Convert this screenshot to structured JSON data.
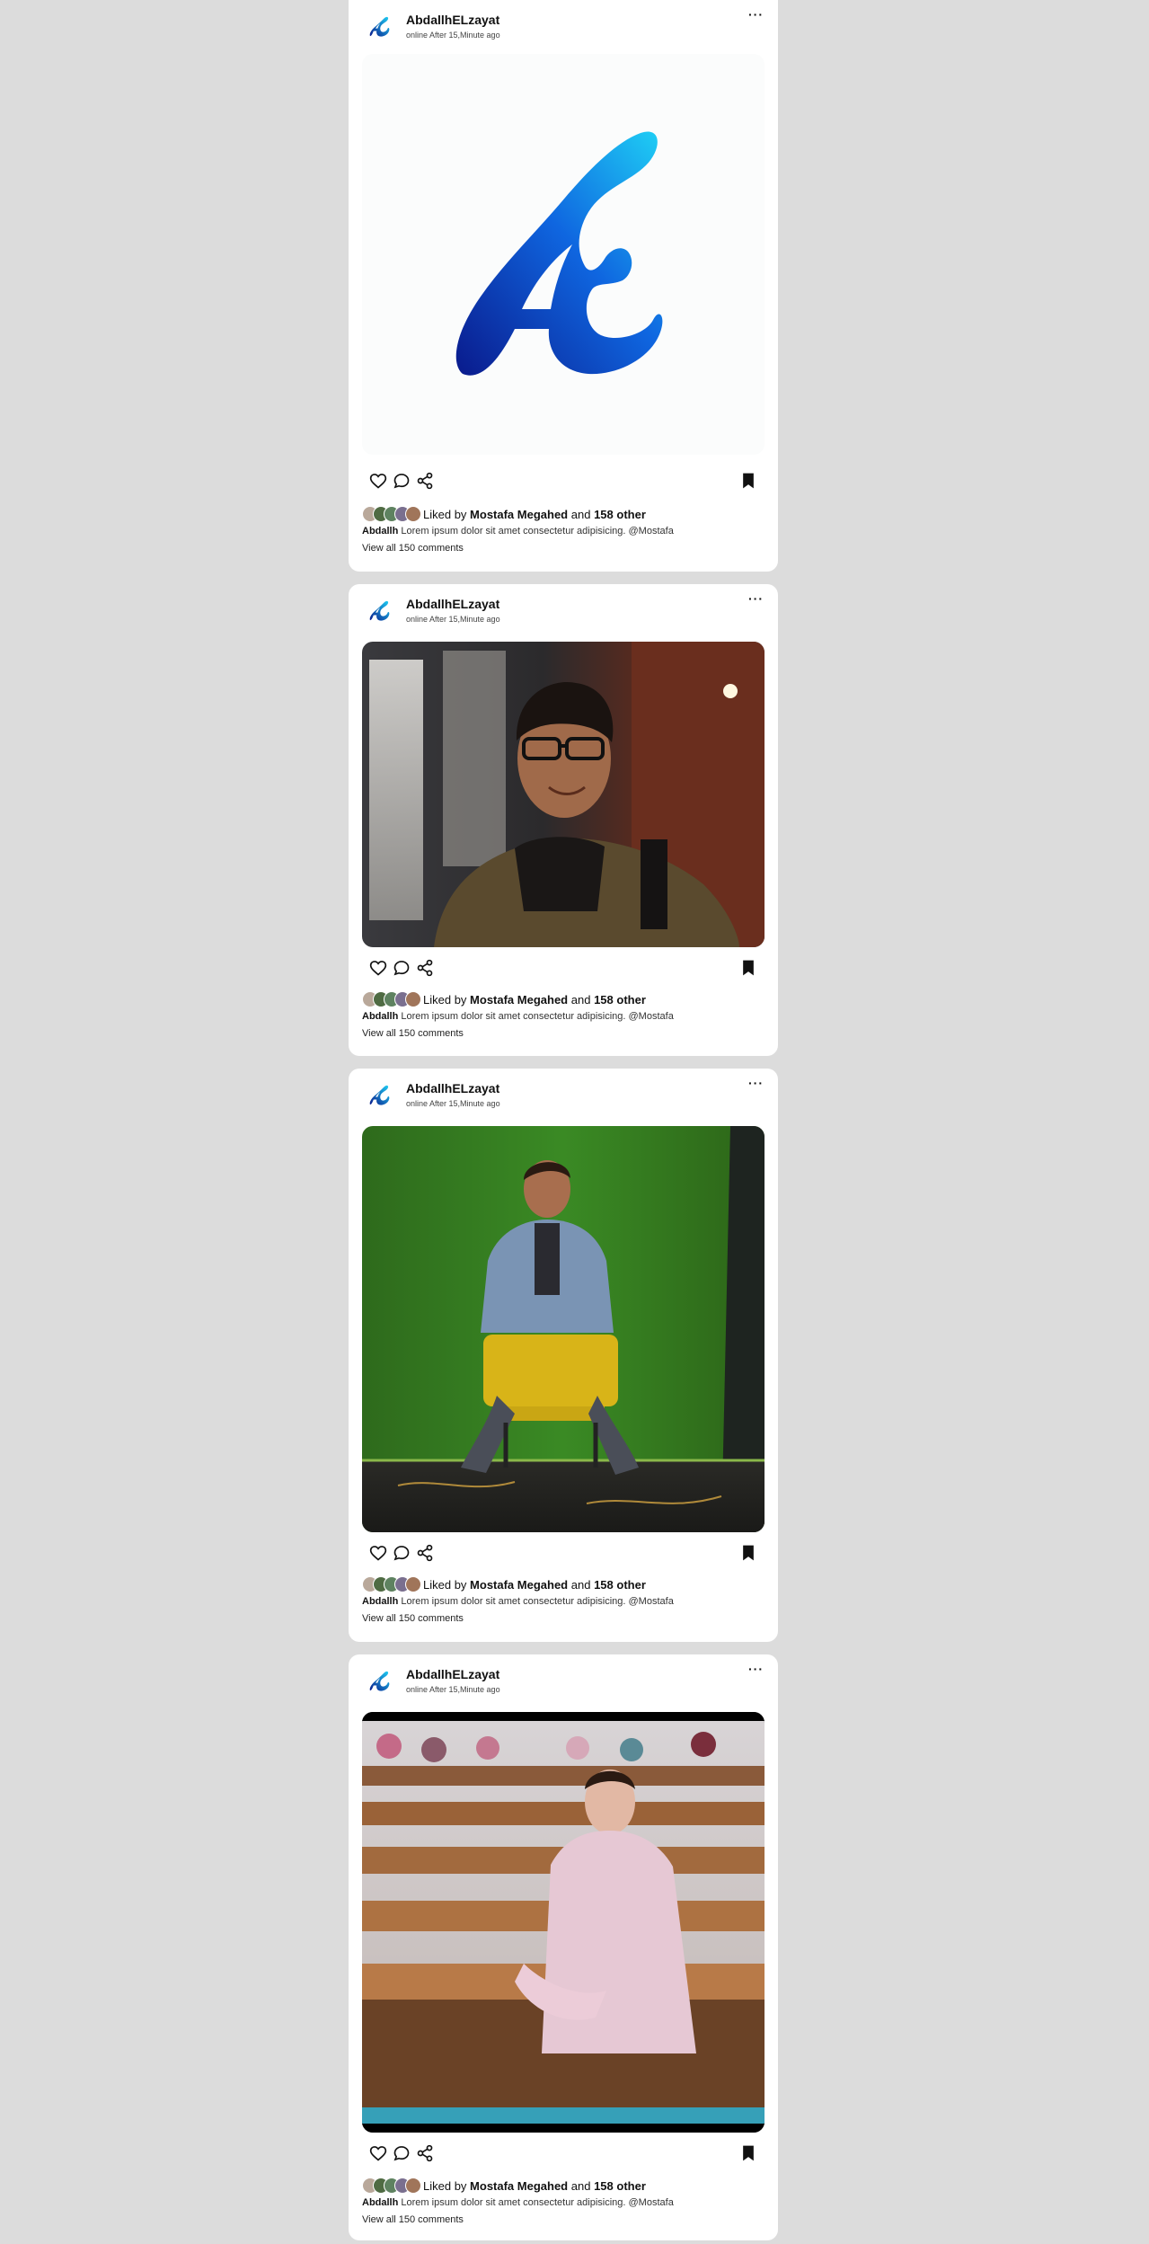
{
  "posts": [
    {
      "username": "AbdallhELzayat",
      "status": "online After 15,Minute ago",
      "more_label": "···",
      "liked_by_prefix": "Liked by",
      "liked_by_name": "Mostafa Megahed",
      "liked_by_and": "and",
      "liked_by_count": "158 other",
      "caption_user": "Abdallh",
      "caption_text": "Lorem ipsum dolor sit amet consectetur adipisicing. @Mostafa",
      "comments_link": "View all 150 comments",
      "media": "logo"
    },
    {
      "username": "AbdallhELzayat",
      "status": "online After 15,Minute ago",
      "more_label": "···",
      "liked_by_prefix": "Liked by",
      "liked_by_name": "Mostafa Megahed",
      "liked_by_and": "and",
      "liked_by_count": "158 other",
      "caption_user": "Abdallh",
      "caption_text": "Lorem ipsum dolor sit amet consectetur adipisicing. @Mostafa",
      "comments_link": "View all 150 comments",
      "media": "photo-selfie"
    },
    {
      "username": "AbdallhELzayat",
      "status": "online After 15,Minute ago",
      "more_label": "···",
      "liked_by_prefix": "Liked by",
      "liked_by_name": "Mostafa Megahed",
      "liked_by_and": "and",
      "liked_by_count": "158 other",
      "caption_user": "Abdallh",
      "caption_text": "Lorem ipsum dolor sit amet consectetur adipisicing. @Mostafa",
      "comments_link": "View all 150 comments",
      "media": "photo-chair"
    },
    {
      "username": "AbdallhELzayat",
      "status": "online After 15,Minute ago",
      "more_label": "···",
      "liked_by_prefix": "Liked by",
      "liked_by_name": "Mostafa Megahed",
      "liked_by_and": "and",
      "liked_by_count": "158 other",
      "caption_user": "Abdallh",
      "caption_text": "Lorem ipsum dolor sit amet consectetur adipisicing. @Mostafa",
      "comments_link": "View all 150 comments",
      "media": "photo-classroom"
    }
  ],
  "icons": {
    "like": "heart-icon",
    "comment": "comment-icon",
    "share": "share-icon",
    "save": "bookmark-icon",
    "more": "more-icon"
  },
  "colors": {
    "page_background": "#dcdcdc",
    "card_background": "#ffffff",
    "logo_gradient_start": "#0a1a8c",
    "logo_gradient_end": "#1fd0f5"
  }
}
